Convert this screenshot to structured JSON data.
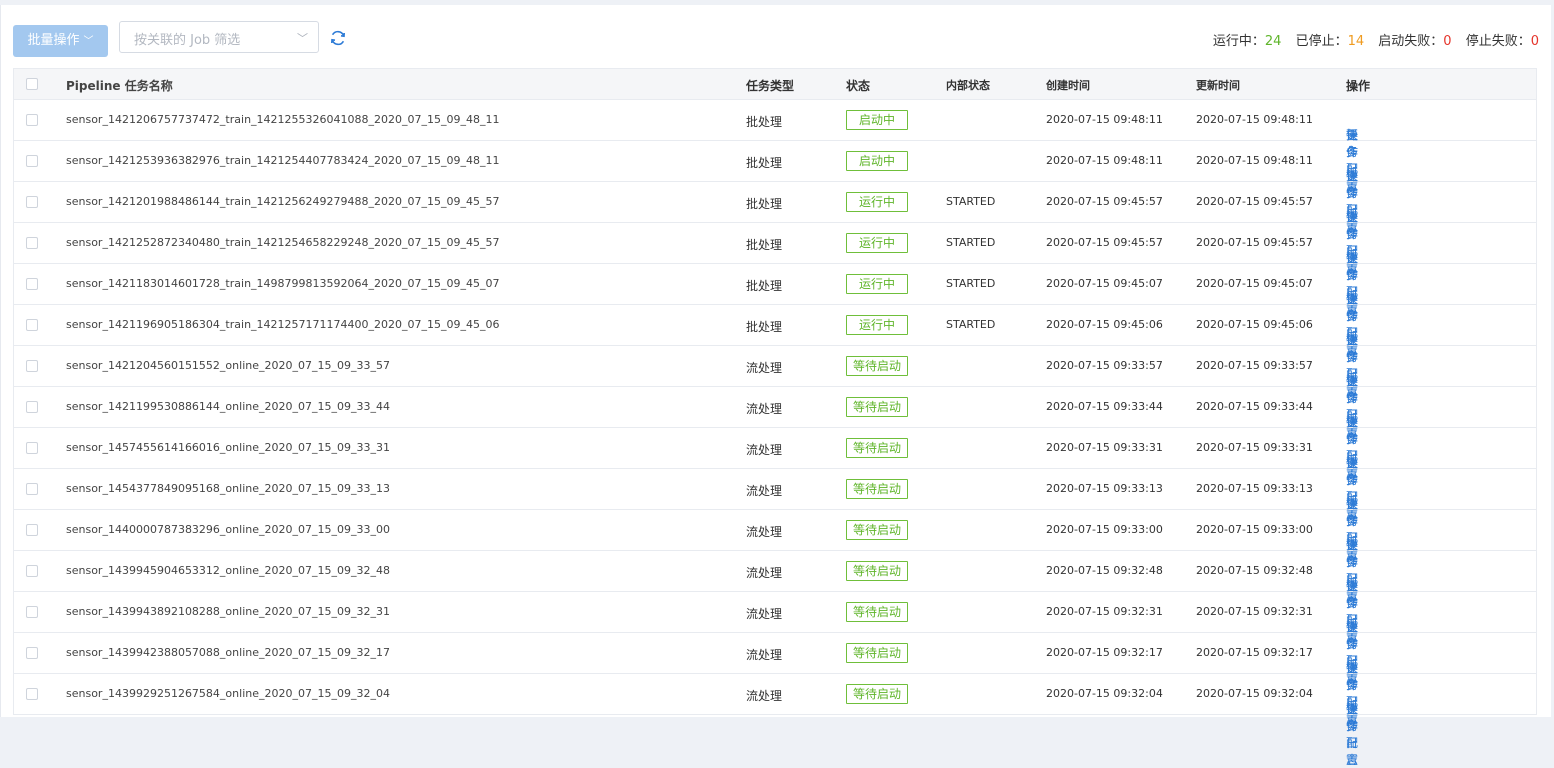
{
  "toolbar": {
    "batch_label": "批量操作",
    "job_filter_placeholder": "按关联的 Job 筛选"
  },
  "stats": {
    "running_label": "运行中：",
    "running_count": "24",
    "stopped_label": "已停止：",
    "stopped_count": "14",
    "start_failed_label": "启动失败：",
    "start_failed_count": "0",
    "stop_failed_label": "停止失败：",
    "stop_failed_count": "0"
  },
  "table": {
    "headers": {
      "name": "Pipeline 任务名称",
      "type": "任务类型",
      "status": "状态",
      "inner_status": "内部状态",
      "created": "创建时间",
      "updated": "更新时间",
      "ops": "操作"
    },
    "op_labels": [
      "任务配置",
      "操作日志",
      "更多"
    ],
    "rows": [
      {
        "name": "sensor_1421206757737472_train_1421255326041088_2020_07_15_09_48_11",
        "type": "批处理",
        "status": "启动中",
        "inner": "",
        "created": "2020-07-15 09:48:11",
        "updated": "2020-07-15 09:48:11"
      },
      {
        "name": "sensor_1421253936382976_train_1421254407783424_2020_07_15_09_48_11",
        "type": "批处理",
        "status": "启动中",
        "inner": "",
        "created": "2020-07-15 09:48:11",
        "updated": "2020-07-15 09:48:11"
      },
      {
        "name": "sensor_1421201988486144_train_1421256249279488_2020_07_15_09_45_57",
        "type": "批处理",
        "status": "运行中",
        "inner": "STARTED",
        "created": "2020-07-15 09:45:57",
        "updated": "2020-07-15 09:45:57"
      },
      {
        "name": "sensor_1421252872340480_train_1421254658229248_2020_07_15_09_45_57",
        "type": "批处理",
        "status": "运行中",
        "inner": "STARTED",
        "created": "2020-07-15 09:45:57",
        "updated": "2020-07-15 09:45:57"
      },
      {
        "name": "sensor_1421183014601728_train_1498799813592064_2020_07_15_09_45_07",
        "type": "批处理",
        "status": "运行中",
        "inner": "STARTED",
        "created": "2020-07-15 09:45:07",
        "updated": "2020-07-15 09:45:07"
      },
      {
        "name": "sensor_1421196905186304_train_1421257171174400_2020_07_15_09_45_06",
        "type": "批处理",
        "status": "运行中",
        "inner": "STARTED",
        "created": "2020-07-15 09:45:06",
        "updated": "2020-07-15 09:45:06"
      },
      {
        "name": "sensor_1421204560151552_online_2020_07_15_09_33_57",
        "type": "流处理",
        "status": "等待启动",
        "inner": "",
        "created": "2020-07-15 09:33:57",
        "updated": "2020-07-15 09:33:57"
      },
      {
        "name": "sensor_1421199530886144_online_2020_07_15_09_33_44",
        "type": "流处理",
        "status": "等待启动",
        "inner": "",
        "created": "2020-07-15 09:33:44",
        "updated": "2020-07-15 09:33:44"
      },
      {
        "name": "sensor_1457455614166016_online_2020_07_15_09_33_31",
        "type": "流处理",
        "status": "等待启动",
        "inner": "",
        "created": "2020-07-15 09:33:31",
        "updated": "2020-07-15 09:33:31"
      },
      {
        "name": "sensor_1454377849095168_online_2020_07_15_09_33_13",
        "type": "流处理",
        "status": "等待启动",
        "inner": "",
        "created": "2020-07-15 09:33:13",
        "updated": "2020-07-15 09:33:13"
      },
      {
        "name": "sensor_1440000787383296_online_2020_07_15_09_33_00",
        "type": "流处理",
        "status": "等待启动",
        "inner": "",
        "created": "2020-07-15 09:33:00",
        "updated": "2020-07-15 09:33:00"
      },
      {
        "name": "sensor_1439945904653312_online_2020_07_15_09_32_48",
        "type": "流处理",
        "status": "等待启动",
        "inner": "",
        "created": "2020-07-15 09:32:48",
        "updated": "2020-07-15 09:32:48"
      },
      {
        "name": "sensor_1439943892108288_online_2020_07_15_09_32_31",
        "type": "流处理",
        "status": "等待启动",
        "inner": "",
        "created": "2020-07-15 09:32:31",
        "updated": "2020-07-15 09:32:31"
      },
      {
        "name": "sensor_1439942388057088_online_2020_07_15_09_32_17",
        "type": "流处理",
        "status": "等待启动",
        "inner": "",
        "created": "2020-07-15 09:32:17",
        "updated": "2020-07-15 09:32:17"
      },
      {
        "name": "sensor_1439929251267584_online_2020_07_15_09_32_04",
        "type": "流处理",
        "status": "等待启动",
        "inner": "",
        "created": "2020-07-15 09:32:04",
        "updated": "2020-07-15 09:32:04"
      }
    ]
  },
  "colors": {
    "accent_link": "#2d7bd6",
    "status_green": "#5fb52a",
    "stopped_orange": "#ef9b20",
    "failed_red": "#e5352b",
    "batch_button": "#a3c8ef"
  },
  "icons": [
    "chevron-down-icon",
    "refresh-icon"
  ]
}
